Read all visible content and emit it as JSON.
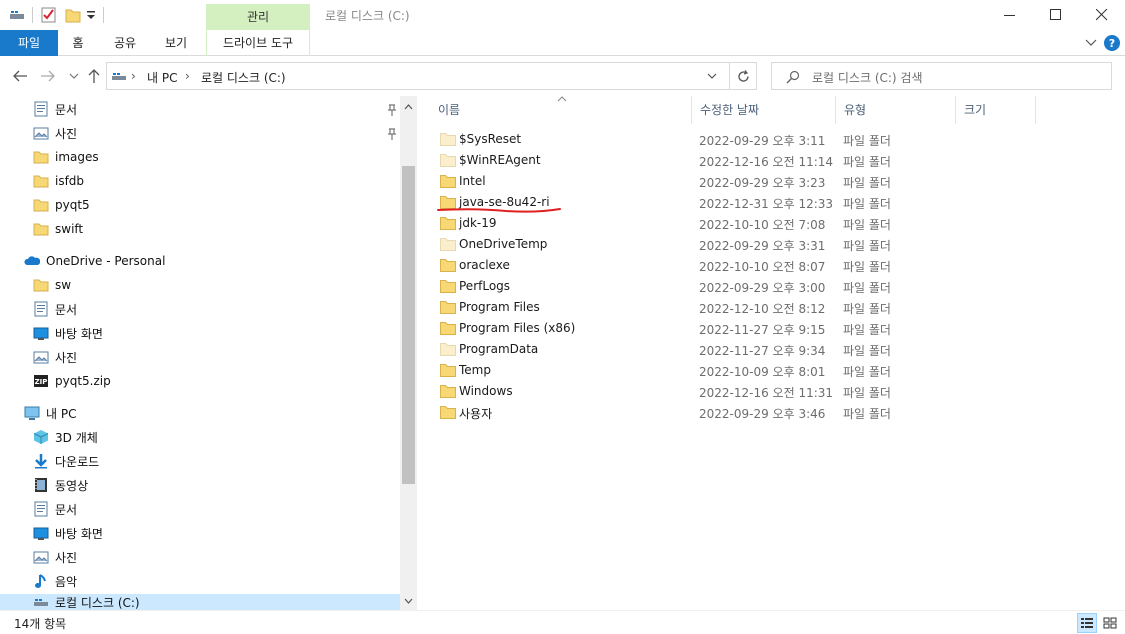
{
  "window": {
    "title": "로컬 디스크 (C:)",
    "context_tab_header": "관리"
  },
  "ribbon": {
    "tabs": [
      "파일",
      "홈",
      "공유",
      "보기",
      "드라이브 도구"
    ],
    "accent_color": "#1979ca",
    "context_color": "#d4f0c0"
  },
  "address": {
    "crumbs": [
      "내 PC",
      "로컬 디스크 (C:)"
    ],
    "search_placeholder": "로컬 디스크 (C:) 검색"
  },
  "nav": {
    "items": [
      {
        "label": "문서",
        "icon": "document-icon"
      },
      {
        "label": "사진",
        "icon": "pictures-icon"
      },
      {
        "label": "images",
        "icon": "folder-icon"
      },
      {
        "label": "isfdb",
        "icon": "folder-icon"
      },
      {
        "label": "pyqt5",
        "icon": "folder-icon"
      },
      {
        "label": "swift",
        "icon": "folder-icon"
      },
      {
        "label": "OneDrive - Personal",
        "icon": "onedrive-icon"
      },
      {
        "label": "sw",
        "icon": "folder-icon"
      },
      {
        "label": "문서",
        "icon": "document-icon"
      },
      {
        "label": "바탕 화면",
        "icon": "desktop-icon"
      },
      {
        "label": "사진",
        "icon": "pictures-icon"
      },
      {
        "label": "pyqt5.zip",
        "icon": "zip-icon"
      },
      {
        "label": "내 PC",
        "icon": "pc-icon"
      },
      {
        "label": "3D 개체",
        "icon": "3d-objects-icon"
      },
      {
        "label": "다운로드",
        "icon": "download-icon"
      },
      {
        "label": "동영상",
        "icon": "video-icon"
      },
      {
        "label": "문서",
        "icon": "document-icon"
      },
      {
        "label": "바탕 화면",
        "icon": "desktop-icon"
      },
      {
        "label": "사진",
        "icon": "pictures-icon"
      },
      {
        "label": "음악",
        "icon": "music-icon"
      },
      {
        "label": "로컬 디스크 (C:)",
        "icon": "drive-icon"
      }
    ]
  },
  "columns": {
    "name": "이름",
    "date": "수정한 날짜",
    "type": "유형",
    "size": "크기"
  },
  "files": [
    {
      "name": "$SysReset",
      "date": "2022-09-29 오후 3:11",
      "type": "파일 폴더",
      "hidden": true
    },
    {
      "name": "$WinREAgent",
      "date": "2022-12-16 오전 11:14",
      "type": "파일 폴더",
      "hidden": true
    },
    {
      "name": "Intel",
      "date": "2022-09-29 오후 3:23",
      "type": "파일 폴더",
      "hidden": false
    },
    {
      "name": "java-se-8u42-ri",
      "date": "2022-12-31 오후 12:33",
      "type": "파일 폴더",
      "hidden": false,
      "annotated": true
    },
    {
      "name": "jdk-19",
      "date": "2022-10-10 오전 7:08",
      "type": "파일 폴더",
      "hidden": false
    },
    {
      "name": "OneDriveTemp",
      "date": "2022-09-29 오후 3:31",
      "type": "파일 폴더",
      "hidden": true
    },
    {
      "name": "oraclexe",
      "date": "2022-10-10 오전 8:07",
      "type": "파일 폴더",
      "hidden": false
    },
    {
      "name": "PerfLogs",
      "date": "2022-09-29 오후 3:00",
      "type": "파일 폴더",
      "hidden": false
    },
    {
      "name": "Program Files",
      "date": "2022-12-10 오전 8:12",
      "type": "파일 폴더",
      "hidden": false
    },
    {
      "name": "Program Files (x86)",
      "date": "2022-11-27 오후 9:15",
      "type": "파일 폴더",
      "hidden": false
    },
    {
      "name": "ProgramData",
      "date": "2022-11-27 오후 9:34",
      "type": "파일 폴더",
      "hidden": true
    },
    {
      "name": "Temp",
      "date": "2022-10-09 오후 8:01",
      "type": "파일 폴더",
      "hidden": false
    },
    {
      "name": "Windows",
      "date": "2022-12-16 오전 11:31",
      "type": "파일 폴더",
      "hidden": false
    },
    {
      "name": "사용자",
      "date": "2022-09-29 오후 3:46",
      "type": "파일 폴더",
      "hidden": false
    }
  ],
  "status": {
    "count": "14개 항목"
  },
  "colors": {
    "folder": "#f8d775",
    "folder_hidden": "#fbeecc",
    "annotation": "#e02020"
  }
}
